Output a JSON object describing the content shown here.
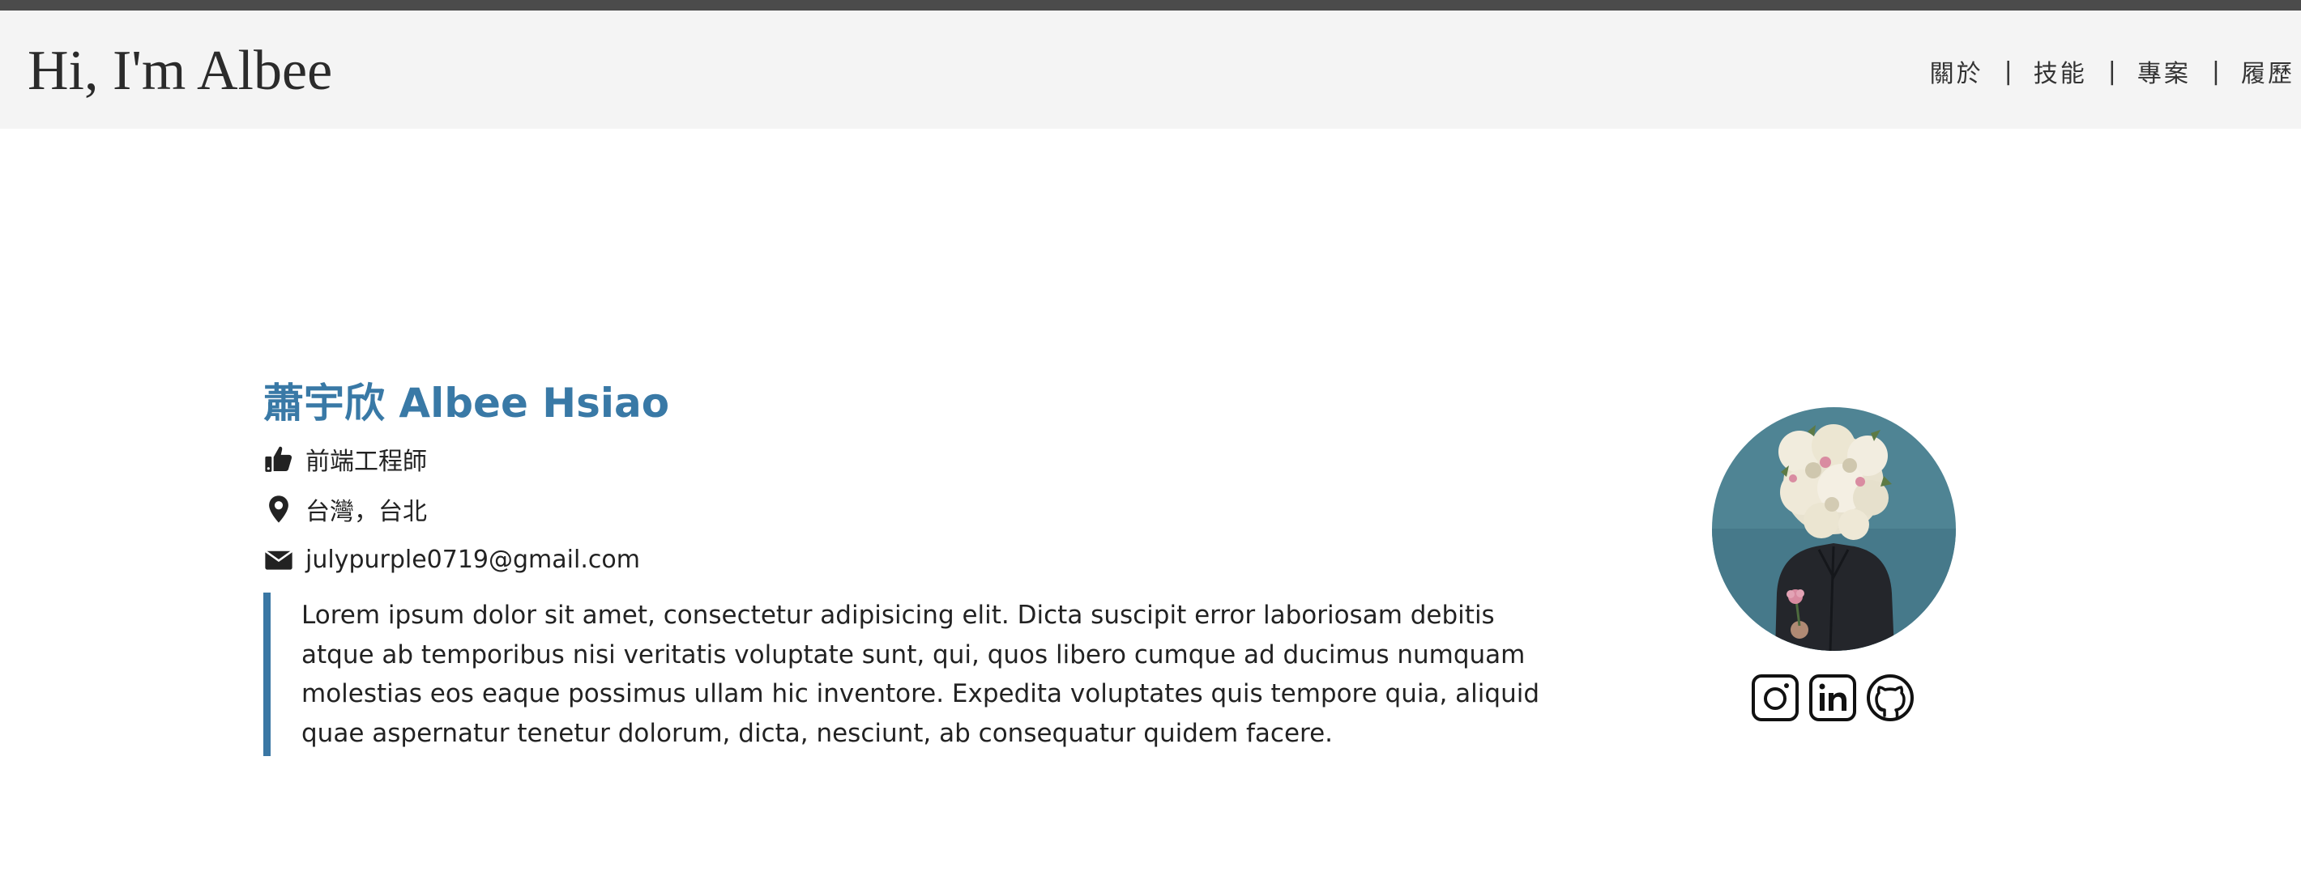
{
  "header": {
    "brand": "Hi, I'm Albee",
    "nav": [
      {
        "label": "關於"
      },
      {
        "label": "技能"
      },
      {
        "label": "專案"
      },
      {
        "label": "履歷"
      }
    ],
    "separator": "|"
  },
  "profile": {
    "name_zh": "蕭宇欣",
    "name_en": "Albee Hsiao",
    "role": "前端工程師",
    "location": "台灣，台北",
    "email": "julypurple0719@gmail.com",
    "bio": "Lorem ipsum dolor sit amet, consectetur adipisicing elit. Dicta suscipit error laboriosam debitis atque ab temporibus nisi veritatis voluptate sunt, qui, quos libero cumque ad ducimus numquam molestias eos eaque possimus ullam hic inventore. Expedita voluptates quis tempore quia, aliquid quae aspernatur tenetur dolorum, dicta, nesciunt, ab consequatur quidem facere."
  },
  "icons": {
    "role": "thumbs-up-icon",
    "location": "map-marker-icon",
    "email": "envelope-icon",
    "socials": [
      "instagram-icon",
      "linkedin-icon",
      "github-icon"
    ]
  },
  "colors": {
    "accent": "#3979a6",
    "nav_background": "#f4f4f4",
    "top_bar": "#4b4b4b",
    "avatar_background": "#4f8494"
  }
}
